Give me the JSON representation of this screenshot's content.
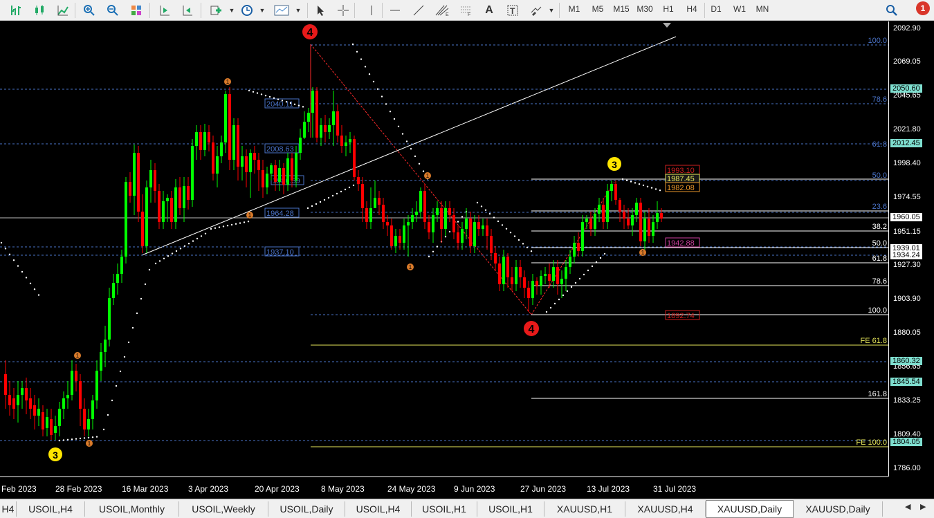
{
  "toolbar": {
    "timeframes": [
      "M1",
      "M5",
      "M15",
      "M30",
      "H1",
      "H4",
      "D1",
      "W1",
      "MN"
    ],
    "notification_count": "1",
    "icons": [
      "bar-chart-icon",
      "candles-icon",
      "line-chart-icon",
      "zoom-in-icon",
      "zoom-out-icon",
      "tile-icon",
      "autoscroll-icon",
      "chart-shift-icon",
      "indicators-icon",
      "periods-icon",
      "templates-icon",
      "cursor-icon",
      "crosshair-icon",
      "vline-icon",
      "hline-icon",
      "trendline-icon",
      "fibo-icon",
      "text-icon",
      "label-icon",
      "shapes-icon",
      "search-icon"
    ]
  },
  "chart": {
    "symbol": "XAUUSD",
    "timeframe": "Daily",
    "background": "#000000",
    "bull_color": "#00ff00",
    "bear_color": "#ff0000"
  },
  "price_axis": {
    "ticks": [
      "2092.90",
      "2069.05",
      "2045.65",
      "2021.80",
      "1998.40",
      "1974.55",
      "1951.15",
      "1927.30",
      "1903.90",
      "1880.05",
      "1856.65",
      "1833.25",
      "1809.40",
      "1786.00"
    ],
    "boxes": [
      {
        "label": "2050.60",
        "color": "#7fdfd0"
      },
      {
        "label": "2012.45",
        "color": "#7fdfd0"
      },
      {
        "label": "1960.05",
        "color": "#ffffff"
      },
      {
        "label": "1939.01",
        "color": "#ffffff"
      },
      {
        "label": "1934.24",
        "color": "#ffffff"
      },
      {
        "label": "1860.32",
        "color": "#7fdfd0"
      },
      {
        "label": "1845.54",
        "color": "#7fdfd0"
      },
      {
        "label": "1804.05",
        "color": "#7fdfd0"
      }
    ]
  },
  "date_axis": [
    "Feb 2023",
    "28 Feb 2023",
    "16 Mar 2023",
    "3 Apr 2023",
    "20 Apr 2023",
    "8 May 2023",
    "24 May 2023",
    "9 Jun 2023",
    "27 Jun 2023",
    "13 Jul 2023",
    "31 Jul 2023"
  ],
  "fib_left": {
    "boxes": [
      "2040.11",
      "2008.63",
      "1986.59",
      "1964.28",
      "1937.10"
    ],
    "levels": [
      "100.0",
      "78.6",
      "61.8",
      "50.0",
      "23.6"
    ]
  },
  "fib_right": {
    "levels": [
      "38.2",
      "50.0",
      "61.8",
      "78.6",
      "100.0",
      "FE 61.8",
      "161.8",
      "FE 100.0"
    ],
    "boxes": [
      "1993.10",
      "1987.45",
      "1982.08",
      "1942.88",
      "1892.74"
    ]
  },
  "wave_labels": {
    "big_4_top": "4",
    "big_4_bottom": "4",
    "small_3_left": "3",
    "small_3_right": "3",
    "sub_1": "1"
  },
  "tabs": {
    "items": [
      "H4",
      "USOIL,H4",
      "USOIL,Monthly",
      "USOIL,Weekly",
      "USOIL,Daily",
      "USOIL,H4",
      "USOIL,H1",
      "USOIL,H1",
      "XAUUSD,H1",
      "XAUUSD,H4",
      "XAUUSD,Daily",
      "XAUUSD,Daily"
    ],
    "active_index": 10
  }
}
